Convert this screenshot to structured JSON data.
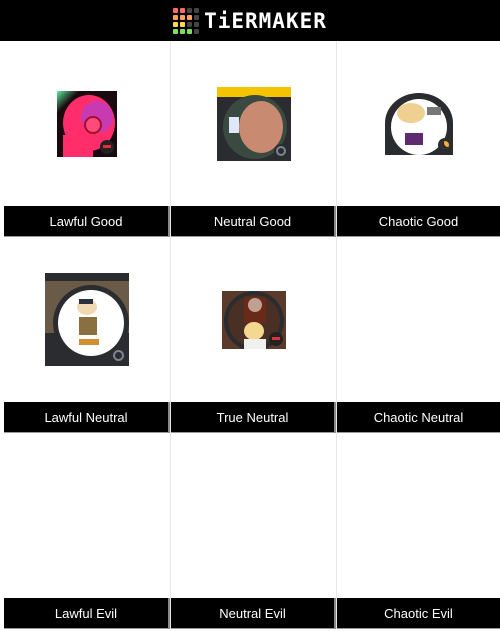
{
  "header": {
    "brand": "TiERMAKER",
    "logo_colors": [
      "#ff6b6b",
      "#ff6b6b",
      "#444444",
      "#444444",
      "#ff9f5a",
      "#ff9f5a",
      "#ff9f5a",
      "#444444",
      "#ffd94a",
      "#ffd94a",
      "#444444",
      "#444444",
      "#7be05a",
      "#7be05a",
      "#7be05a",
      "#444444"
    ]
  },
  "tiers": [
    {
      "label": "Lawful Good",
      "items": [
        {
          "name": "pink-head-avatar",
          "status": "dnd"
        }
      ]
    },
    {
      "label": "Neutral Good",
      "items": [
        {
          "name": "person-photo-avatar",
          "status": "offline"
        }
      ]
    },
    {
      "label": "Chaotic Good",
      "items": [
        {
          "name": "anime-gun-avatar",
          "status": "idle"
        }
      ]
    },
    {
      "label": "Lawful Neutral",
      "items": [
        {
          "name": "cat-character-avatar",
          "status": "offline"
        }
      ]
    },
    {
      "label": "True Neutral",
      "items": [
        {
          "name": "cartoon-duo-avatar",
          "status": "dnd"
        }
      ]
    },
    {
      "label": "Chaotic Neutral",
      "items": []
    },
    {
      "label": "Lawful Evil",
      "items": []
    },
    {
      "label": "Neutral Evil",
      "items": []
    },
    {
      "label": "Chaotic Evil",
      "items": []
    }
  ],
  "colors": {
    "status_dnd": "#e0303a",
    "status_idle": "#f0b232",
    "status_offline": "#80848e"
  }
}
